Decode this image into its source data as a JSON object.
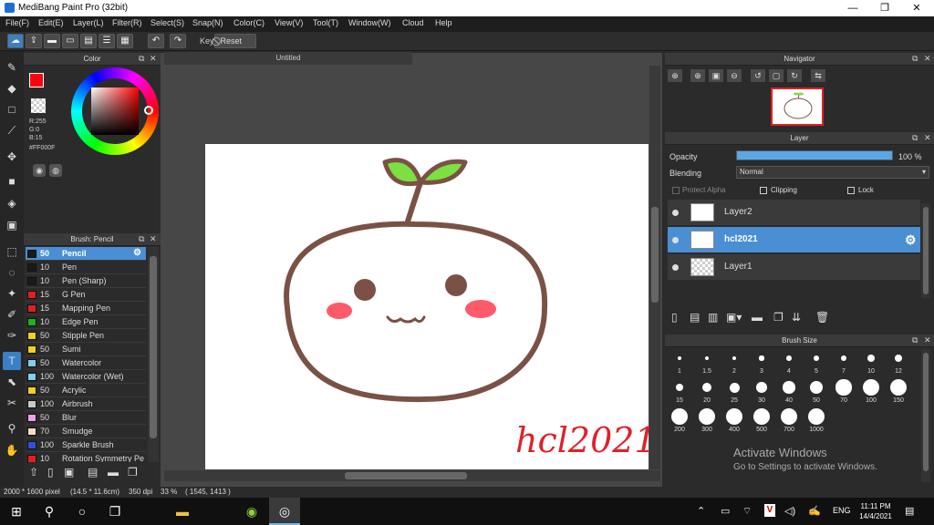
{
  "window": {
    "title": "MediBang Paint Pro (32bit)",
    "minimize": "—",
    "maximize": "❐",
    "close": "✕"
  },
  "menu": [
    "File(F)",
    "Edit(E)",
    "Layer(L)",
    "Filter(R)",
    "Select(S)",
    "Snap(N)",
    "Color(C)",
    "View(V)",
    "Tool(T)",
    "Window(W)",
    "Cloud",
    "Help"
  ],
  "toolbar": {
    "key_label": "Key",
    "reset_label": "Reset"
  },
  "color_panel": {
    "title": "Color",
    "r": "R:255",
    "g": "G:0",
    "b": "B:15",
    "hex": "#FF000F",
    "primary_color": "#ff000f"
  },
  "brush_panel": {
    "title": "Brush: Pencil",
    "items": [
      {
        "size": "50",
        "name": "Pencil",
        "color": "#1a1a1a"
      },
      {
        "size": "10",
        "name": "Pen",
        "color": "#1a1a1a"
      },
      {
        "size": "10",
        "name": "Pen (Sharp)",
        "color": "#1a1a1a"
      },
      {
        "size": "15",
        "name": "G Pen",
        "color": "#e02020"
      },
      {
        "size": "15",
        "name": "Mapping Pen",
        "color": "#e02020"
      },
      {
        "size": "10",
        "name": "Edge Pen",
        "color": "#20b020"
      },
      {
        "size": "50",
        "name": "Stipple Pen",
        "color": "#f0d020"
      },
      {
        "size": "50",
        "name": "Sumi",
        "color": "#f0d020"
      },
      {
        "size": "50",
        "name": "Watercolor",
        "color": "#7fd0f0"
      },
      {
        "size": "100",
        "name": "Watercolor (Wet)",
        "color": "#7fd0f0"
      },
      {
        "size": "50",
        "name": "Acrylic",
        "color": "#f0d020"
      },
      {
        "size": "100",
        "name": "Airbrush",
        "color": "#c8c8c8"
      },
      {
        "size": "50",
        "name": "Blur",
        "color": "#f0a0f0"
      },
      {
        "size": "70",
        "name": "Smudge",
        "color": "#f0e0c0"
      },
      {
        "size": "100",
        "name": "Sparkle Brush",
        "color": "#3050e0"
      },
      {
        "size": "10",
        "name": "Rotation Symmetry Pe",
        "color": "#e02020"
      }
    ]
  },
  "canvas": {
    "tab_title": "Untitled",
    "signature": "hcl2021"
  },
  "navigator": {
    "title": "Navigator"
  },
  "layer_panel": {
    "title": "Layer",
    "opacity_label": "Opacity",
    "opacity_value": "100 %",
    "opacity_percent": 100,
    "blending_label": "Blending",
    "blending_value": "Normal",
    "protect_alpha": "Protect Alpha",
    "clipping": "Clipping",
    "lock": "Lock",
    "layers": [
      {
        "name": "Layer2",
        "selected": false
      },
      {
        "name": "hcl2021",
        "selected": true
      },
      {
        "name": "Layer1",
        "selected": false
      }
    ]
  },
  "brush_size_panel": {
    "title": "Brush Size",
    "sizes": [
      "1",
      "1.5",
      "2",
      "3",
      "4",
      "5",
      "7",
      "10",
      "12",
      "15",
      "20",
      "25",
      "30",
      "40",
      "50",
      "70",
      "100",
      "150",
      "200",
      "300",
      "400",
      "500",
      "700",
      "1000"
    ]
  },
  "status": {
    "dimensions": "2000 * 1600 pixel",
    "physical": "(14.5 * 11.6cm)",
    "dpi": "350 dpi",
    "zoom": "33 %",
    "coords": "( 1545, 1413 )"
  },
  "watermark": {
    "line1": "Activate Windows",
    "line2": "Go to Settings to activate Windows."
  },
  "taskbar": {
    "time": "11:11 PM",
    "date": "14/4/2021",
    "lang": "ENG"
  }
}
